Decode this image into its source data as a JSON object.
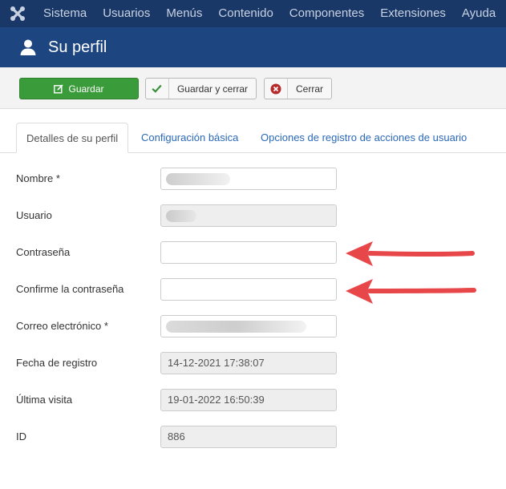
{
  "topnav": {
    "items": [
      "Sistema",
      "Usuarios",
      "Menús",
      "Contenido",
      "Componentes",
      "Extensiones",
      "Ayuda"
    ]
  },
  "header": {
    "title": "Su perfil"
  },
  "toolbar": {
    "save_label": "Guardar",
    "save_close_label": "Guardar y cerrar",
    "close_label": "Cerrar"
  },
  "tabs": [
    "Detalles de su perfil",
    "Configuración básica",
    "Opciones de registro de acciones de usuario"
  ],
  "form": {
    "name_label": "Nombre *",
    "username_label": "Usuario",
    "password_label": "Contraseña",
    "password_value": "",
    "confirm_label": "Confirme la contraseña",
    "confirm_value": "",
    "email_label": "Correo electrónico *",
    "registered_label": "Fecha de registro",
    "registered_value": "14-12-2021 17:38:07",
    "lastvisit_label": "Última visita",
    "lastvisit_value": "19-01-2022 16:50:39",
    "id_label": "ID",
    "id_value": "886"
  },
  "colors": {
    "nav_bg": "#1a3867",
    "title_bg": "#1d4580",
    "save_green": "#3a9b3a",
    "link_blue": "#2a69b8",
    "arrow_red": "#e8474a"
  },
  "icons": [
    "joomla-logo-icon",
    "user-icon",
    "edit-icon",
    "check-icon",
    "close-circle-icon",
    "arrow-left-icon"
  ]
}
